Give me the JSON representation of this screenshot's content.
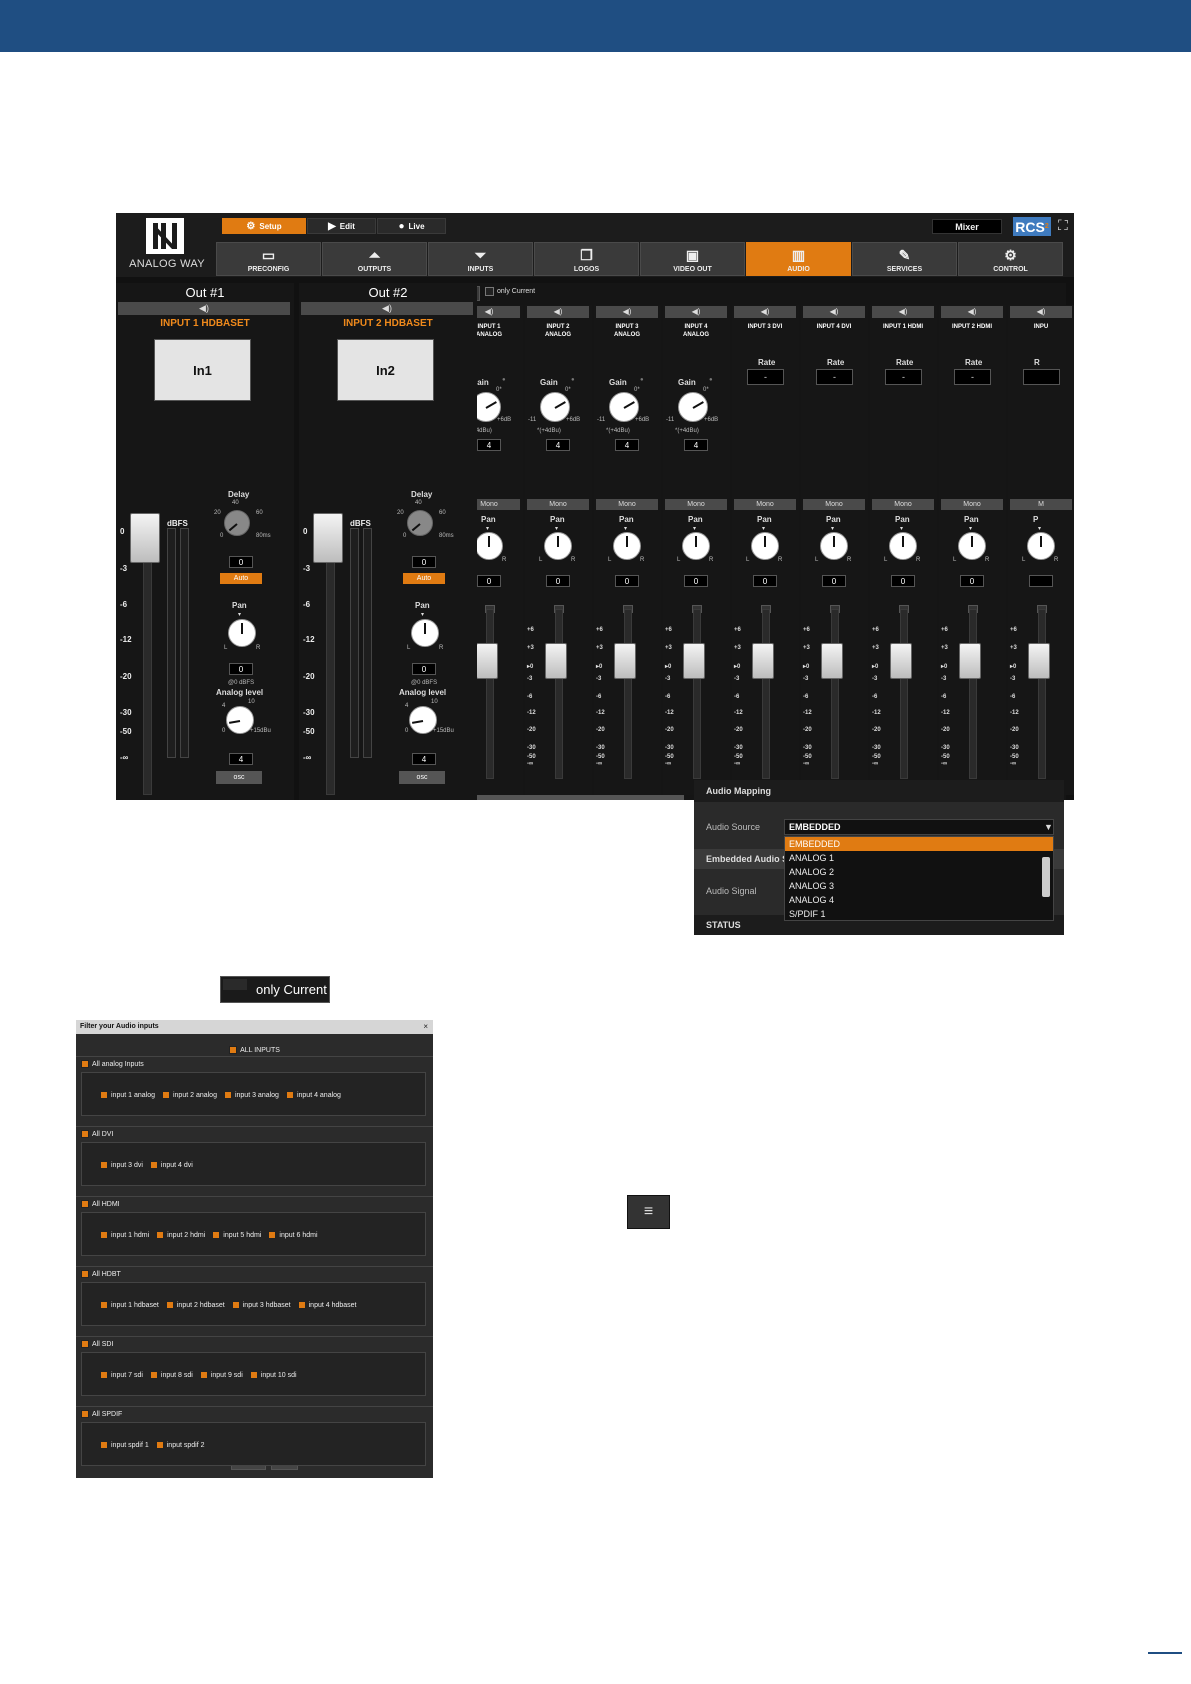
{
  "app": {
    "brand": "ANALOG WAY",
    "modes": [
      {
        "label": "Setup",
        "icon": "gear-icon",
        "active": true
      },
      {
        "label": "Edit",
        "icon": "play-icon",
        "active": false
      },
      {
        "label": "Live",
        "icon": "record-icon",
        "active": false
      }
    ],
    "mixer_label": "Mixer",
    "rcs_label": "RCS",
    "rcs_sup": "2",
    "nav": [
      {
        "label": "PRECONFIG",
        "icon": "preconfig-icon",
        "active": false
      },
      {
        "label": "OUTPUTS",
        "icon": "outputs-icon",
        "active": false
      },
      {
        "label": "INPUTS",
        "icon": "inputs-icon",
        "active": false
      },
      {
        "label": "LOGOS",
        "icon": "logos-icon",
        "active": false
      },
      {
        "label": "VIDEO OUT",
        "icon": "video-out-icon",
        "active": false
      },
      {
        "label": "AUDIO",
        "icon": "audio-bars-icon",
        "active": true
      },
      {
        "label": "SERVICES",
        "icon": "services-icon",
        "active": false
      },
      {
        "label": "CONTROL",
        "icon": "gears-icon",
        "active": false
      }
    ],
    "outputs": [
      {
        "title": "Out #1",
        "source": "INPUT 1 HDBASET",
        "thumb": "In1",
        "delay_label": "Delay",
        "delay_value": "0",
        "auto_label": "Auto",
        "pan_label": "Pan",
        "pan_value": "0",
        "ref_label": "@0 dBFS",
        "analog_label": "Analog level",
        "analog_value": "4",
        "osc_label": "osc"
      },
      {
        "title": "Out #2",
        "source": "INPUT 2 HDBASET",
        "thumb": "In2",
        "delay_label": "Delay",
        "delay_value": "0",
        "auto_label": "Auto",
        "pan_label": "Pan",
        "pan_value": "0",
        "ref_label": "@0 dBFS",
        "analog_label": "Analog level",
        "analog_value": "4",
        "osc_label": "osc"
      }
    ],
    "out_scale": [
      "0",
      "-3",
      "-6",
      "-12",
      "-20",
      "-30",
      "-50",
      "-∞"
    ],
    "dbfs_label": "dBFS",
    "delay_ticks": [
      "40",
      "20",
      "60",
      "0",
      "80ms"
    ],
    "analog_ticks": [
      "4",
      "10",
      "0",
      "+15dBu"
    ],
    "pan_lr": [
      "L",
      "R"
    ],
    "only_current": "only Current",
    "inputs": [
      {
        "name": "INPUT 1\nANALOG",
        "type": "analog",
        "gain_label": "Gain",
        "gain_value": "4",
        "mono": "Mono",
        "pan_label": "Pan",
        "pan_value": "0"
      },
      {
        "name": "INPUT 2\nANALOG",
        "type": "analog",
        "gain_label": "Gain",
        "gain_value": "4",
        "mono": "Mono",
        "pan_label": "Pan",
        "pan_value": "0"
      },
      {
        "name": "INPUT 3\nANALOG",
        "type": "analog",
        "gain_label": "Gain",
        "gain_value": "4",
        "mono": "Mono",
        "pan_label": "Pan",
        "pan_value": "0"
      },
      {
        "name": "INPUT 4\nANALOG",
        "type": "analog",
        "gain_label": "Gain",
        "gain_value": "4",
        "mono": "Mono",
        "pan_label": "Pan",
        "pan_value": "0"
      },
      {
        "name": "INPUT 3 DVI",
        "type": "digital",
        "rate_label": "Rate",
        "rate_value": "-",
        "mono": "Mono",
        "pan_label": "Pan",
        "pan_value": "0"
      },
      {
        "name": "INPUT 4 DVI",
        "type": "digital",
        "rate_label": "Rate",
        "rate_value": "-",
        "mono": "Mono",
        "pan_label": "Pan",
        "pan_value": "0"
      },
      {
        "name": "INPUT 1 HDMI",
        "type": "digital",
        "rate_label": "Rate",
        "rate_value": "-",
        "mono": "Mono",
        "pan_label": "Pan",
        "pan_value": "0"
      },
      {
        "name": "INPUT 2 HDMI",
        "type": "digital",
        "rate_label": "Rate",
        "rate_value": "-",
        "mono": "Mono",
        "pan_label": "Pan",
        "pan_value": "0"
      },
      {
        "name": "INPU",
        "type": "digital",
        "rate_label": "R",
        "rate_value": "",
        "mono": "M",
        "pan_label": "P",
        "pan_value": ""
      }
    ],
    "gain_ticks": [
      "0*",
      "-11",
      "+6dB",
      "*(+4dBu)"
    ],
    "strip_scale": [
      "+6",
      "+3",
      "▸0",
      "-3",
      "-6",
      "-12",
      "-20",
      "-30",
      "-50",
      "-∞"
    ]
  },
  "audio_mapping": {
    "title": "Audio Mapping",
    "source_label": "Audio Source",
    "selected": "EMBEDDED",
    "embedded_label": "Embedded Audio S",
    "signal_label": "Audio Signal",
    "status_label": "STATUS",
    "options": [
      "EMBEDDED",
      "ANALOG 1",
      "ANALOG 2",
      "ANALOG 3",
      "ANALOG 4",
      "S/PDIF 1"
    ]
  },
  "only_current_widget": "only Current",
  "menu_widget_icon": "hamburger-icon",
  "filter": {
    "title": "Filter your Audio inputs",
    "close": "×",
    "all_inputs": "ALL INPUTS",
    "groups": [
      {
        "label": "All analog Inputs",
        "items": [
          "input 1 analog",
          "input 2 analog",
          "input 3 analog",
          "input 4 analog"
        ]
      },
      {
        "label": "All DVI",
        "items": [
          "input 3 dvi",
          "input 4 dvi"
        ]
      },
      {
        "label": "All HDMI",
        "items": [
          "input 1 hdmi",
          "input 2 hdmi",
          "input 5 hdmi",
          "input 6 hdmi"
        ]
      },
      {
        "label": "All HDBT",
        "items": [
          "input 1 hdbaset",
          "input 2 hdbaset",
          "input 3 hdbaset",
          "input 4 hdbaset"
        ]
      },
      {
        "label": "All SDI",
        "items": [
          "input 7 sdi",
          "input 8 sdi",
          "input 9 sdi",
          "input 10 sdi"
        ]
      },
      {
        "label": "All SPDIF",
        "items": [
          "input spdif 1",
          "input spdif 2"
        ]
      }
    ],
    "cancel": "Cancel",
    "save": "Save"
  }
}
